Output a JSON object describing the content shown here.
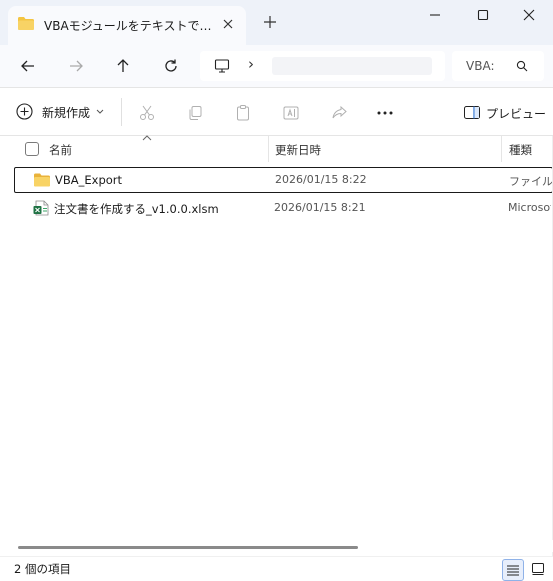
{
  "tab": {
    "title": "VBAモジュールをテキストでエクスポ·",
    "icon": "folder-icon",
    "close_icon": "close-icon"
  },
  "window_controls": [
    "minimize-icon",
    "maximize-icon",
    "close-icon"
  ],
  "nav": {
    "buttons": [
      "back-arrow-icon",
      "forward-arrow-icon",
      "up-arrow-icon",
      "refresh-icon"
    ],
    "address_chevron": "›",
    "search_placeholder": "VBA:"
  },
  "toolbar": {
    "new_label": "新規作成",
    "preview_label": "プレビュー",
    "icons": [
      "cut-icon",
      "copy-icon",
      "paste-icon",
      "rename-icon",
      "share-icon",
      "more-icon"
    ]
  },
  "columns": {
    "name": "名前",
    "modified": "更新日時",
    "type": "種類"
  },
  "files": [
    {
      "name": "VBA_Export",
      "modified": "2026/01/15 8:22",
      "type": "ファイル フ",
      "icon": "folder-icon",
      "selected": true
    },
    {
      "name": "注文書を作成する_v1.0.0.xlsm",
      "modified": "2026/01/15 8:21",
      "type": "Microsoft",
      "icon": "excel-file-icon",
      "selected": false
    }
  ],
  "status": {
    "item_count": "2 個の項目"
  },
  "colors": {
    "title_bg": "#eef2f9",
    "folder_yellow": "#f4c542",
    "accent_blue": "#3a7bd5",
    "excel_green": "#1f7244"
  }
}
